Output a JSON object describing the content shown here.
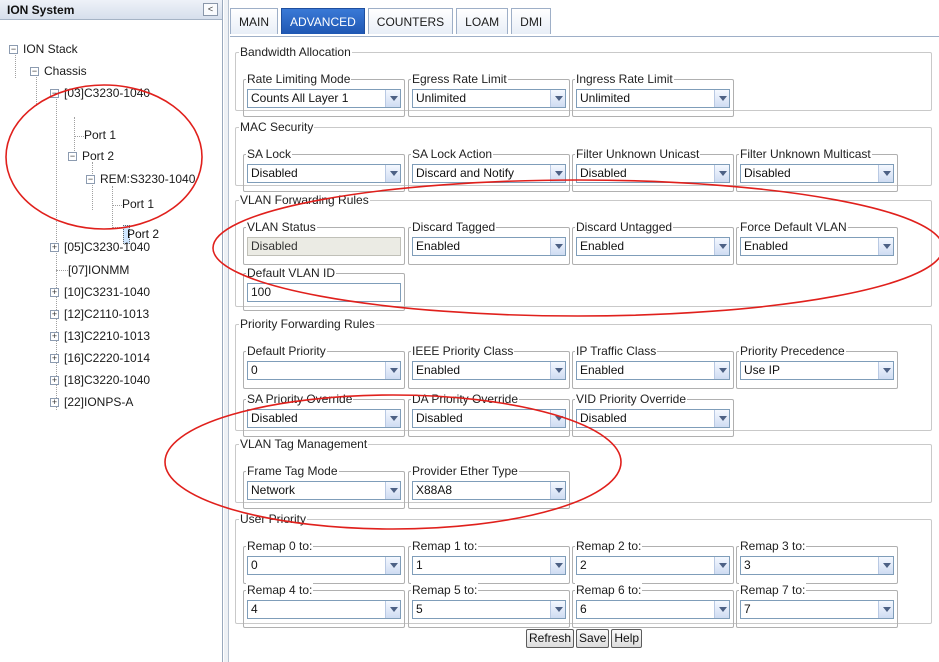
{
  "left_panel": {
    "title": "ION System",
    "collapse_glyph": "<",
    "tree": {
      "ion_stack": "ION Stack",
      "chassis": "Chassis",
      "c03": "[03]C3230-1040",
      "c03_port1": "Port 1",
      "c03_port2": "Port 2",
      "rem": "REM:S3230-1040",
      "rem_port1": "Port 1",
      "rem_port2": "Port 2",
      "c05": "[05]C3230-1040",
      "c07": "[07]IONMM",
      "c10": "[10]C3231-1040",
      "c12": "[12]C2110-1013",
      "c13": "[13]C2210-1013",
      "c16": "[16]C2220-1014",
      "c18": "[18]C3220-1040",
      "c22": "[22]IONPS-A"
    },
    "expand_glyph": "+",
    "collapse_node_glyph": "−"
  },
  "tabs": [
    "MAIN",
    "ADVANCED",
    "COUNTERS",
    "LOAM",
    "DMI"
  ],
  "active_tab": "ADVANCED",
  "bandwidth": {
    "title": "Bandwidth Allocation",
    "rate_limiting_mode": {
      "label": "Rate Limiting Mode",
      "value": "Counts All Layer 1"
    },
    "egress_rate_limit": {
      "label": "Egress Rate Limit",
      "value": "Unlimited"
    },
    "ingress_rate_limit": {
      "label": "Ingress Rate Limit",
      "value": "Unlimited"
    }
  },
  "mac_security": {
    "title": "MAC Security",
    "sa_lock": {
      "label": "SA Lock",
      "value": "Disabled"
    },
    "sa_lock_action": {
      "label": "SA Lock Action",
      "value": "Discard and Notify"
    },
    "filter_unknown_unicast": {
      "label": "Filter Unknown Unicast",
      "value": "Disabled"
    },
    "filter_unknown_multicast": {
      "label": "Filter Unknown Multicast",
      "value": "Disabled"
    }
  },
  "vlan_forwarding": {
    "title": "VLAN Forwarding Rules",
    "vlan_status": {
      "label": "VLAN Status",
      "value": "Disabled"
    },
    "discard_tagged": {
      "label": "Discard Tagged",
      "value": "Enabled"
    },
    "discard_untagged": {
      "label": "Discard Untagged",
      "value": "Enabled"
    },
    "force_default_vlan": {
      "label": "Force Default VLAN",
      "value": "Enabled"
    },
    "default_vlan_id": {
      "label": "Default VLAN ID",
      "value": "100"
    }
  },
  "priority_forwarding": {
    "title": "Priority Forwarding Rules",
    "default_priority": {
      "label": "Default Priority",
      "value": "0"
    },
    "ieee_priority_class": {
      "label": "IEEE Priority Class",
      "value": "Enabled"
    },
    "ip_traffic_class": {
      "label": "IP Traffic Class",
      "value": "Enabled"
    },
    "priority_precedence": {
      "label": "Priority Precedence",
      "value": "Use IP"
    },
    "sa_priority_override": {
      "label": "SA Priority Override",
      "value": "Disabled"
    },
    "da_priority_override": {
      "label": "DA Priority Override",
      "value": "Disabled"
    },
    "vid_priority_override": {
      "label": "VID Priority Override",
      "value": "Disabled"
    }
  },
  "vlan_tag_mgmt": {
    "title": "VLAN Tag Management",
    "frame_tag_mode": {
      "label": "Frame Tag Mode",
      "value": "Network"
    },
    "provider_ether_type": {
      "label": "Provider Ether Type",
      "value": "X88A8"
    }
  },
  "user_priority": {
    "title": "User Priority",
    "remaps": [
      {
        "label": "Remap 0 to:",
        "value": "0"
      },
      {
        "label": "Remap 1 to:",
        "value": "1"
      },
      {
        "label": "Remap 2 to:",
        "value": "2"
      },
      {
        "label": "Remap 3 to:",
        "value": "3"
      },
      {
        "label": "Remap 4 to:",
        "value": "4"
      },
      {
        "label": "Remap 5 to:",
        "value": "5"
      },
      {
        "label": "Remap 6 to:",
        "value": "6"
      },
      {
        "label": "Remap 7 to:",
        "value": "7"
      }
    ]
  },
  "buttons": {
    "refresh": "Refresh",
    "save": "Save",
    "help": "Help"
  },
  "annotation_color": "#e0201c"
}
